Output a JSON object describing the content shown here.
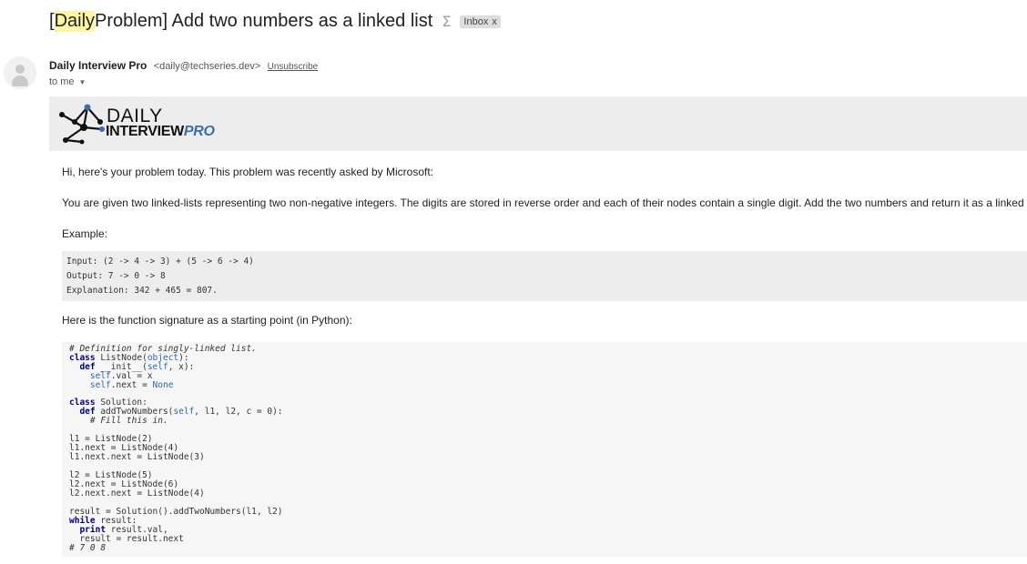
{
  "email": {
    "subject_bracket": "[",
    "subject_highlight": "Daily",
    "subject_rest": " Problem] Add two numbers as a linked list",
    "label_badge": "Inbox",
    "label_close": "x",
    "sender_name": "Daily Interview Pro",
    "sender_email": "<daily@techseries.dev>",
    "unsubscribe": "Unsubscribe",
    "to_line": "to me"
  },
  "banner": {
    "logo_line1": "DAILY",
    "logo_line2a": "INTERVIEW",
    "logo_line2b": "PRO"
  },
  "body": {
    "intro": "Hi, here's your problem today. This problem was recently asked by Microsoft:",
    "problem": "You are given two linked-lists representing two non-negative integers. The digits are stored in reverse order and each of their nodes contain a single digit. Add the two numbers and return it as a linked list.",
    "example_label": "Example:",
    "example_lines": [
      "Input: (2 -> 4 -> 3) + (5 -> 6 -> 4)",
      "Output: 7 -> 0 -> 8",
      "Explanation: 342 + 465 = 807."
    ],
    "signature_intro": "Here is the function signature as a starting point (in Python):"
  },
  "code": {
    "l1": "# Definition for singly-linked list.",
    "l2_kw": "class",
    "l2_name": " ListNode(",
    "l2_base": "object",
    "l2_end": "):",
    "l3_kw": "  def",
    "l3_rest": " __init__(",
    "l3_self": "self",
    "l3_end": ", x):",
    "l4_self": "    self",
    "l4_rest": ".val = x",
    "l5_self": "    self",
    "l5_rest": ".next = ",
    "l5_none": "None",
    "l6_kw": "class",
    "l6_rest": " Solution:",
    "l7_kw": "  def",
    "l7_rest": " addTwoNumbers(",
    "l7_self": "self",
    "l7_end": ", l1, l2, c = 0):",
    "l8": "    # Fill this in.",
    "l9": "l1 = ListNode(2)",
    "l10": "l1.next = ListNode(4)",
    "l11": "l1.next.next = ListNode(3)",
    "l12": "l2 = ListNode(5)",
    "l13": "l2.next = ListNode(6)",
    "l14": "l2.next.next = ListNode(4)",
    "l15": "result = Solution().addTwoNumbers(l1, l2)",
    "l16_kw": "while",
    "l16_rest": " result:",
    "l17_kw": "  print",
    "l17_rest": " result.val,",
    "l18": "  result = result.next",
    "l19": "# 7 0 8"
  },
  "icons": {
    "avatar": "person-avatar-icon",
    "snooze": "sigma-importance-icon",
    "caret": "chevron-down-icon"
  }
}
